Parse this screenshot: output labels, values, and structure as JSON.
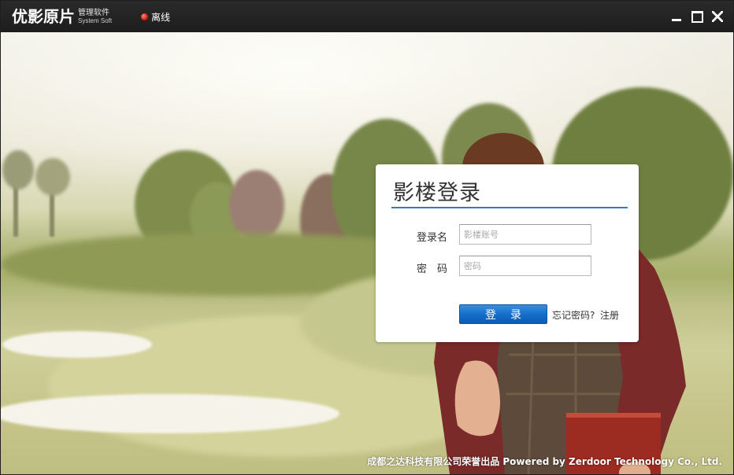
{
  "titlebar": {
    "logo_main": "优影原片",
    "logo_sub_cn": "管理软件",
    "logo_sub_en": "System Soft",
    "status_text": "离线",
    "status_color": "#d81d12"
  },
  "login": {
    "title": "影楼登录",
    "accent_color": "#2d7dbf",
    "username_label": "登录名",
    "username_placeholder": "影楼账号",
    "username_value": "",
    "password_label": "密　码",
    "password_placeholder": "密码",
    "password_value": "",
    "submit_label": "登录",
    "forgot_label": "忘记密码?",
    "register_label": "注册"
  },
  "footer": {
    "text": "成都之达科技有限公司荣誉出品 Powered by Zerdoor Technology Co., Ltd."
  },
  "icons": {
    "minimize": "minimize-icon",
    "maximize": "maximize-icon",
    "close": "close-icon",
    "status": "status-dot-icon"
  }
}
